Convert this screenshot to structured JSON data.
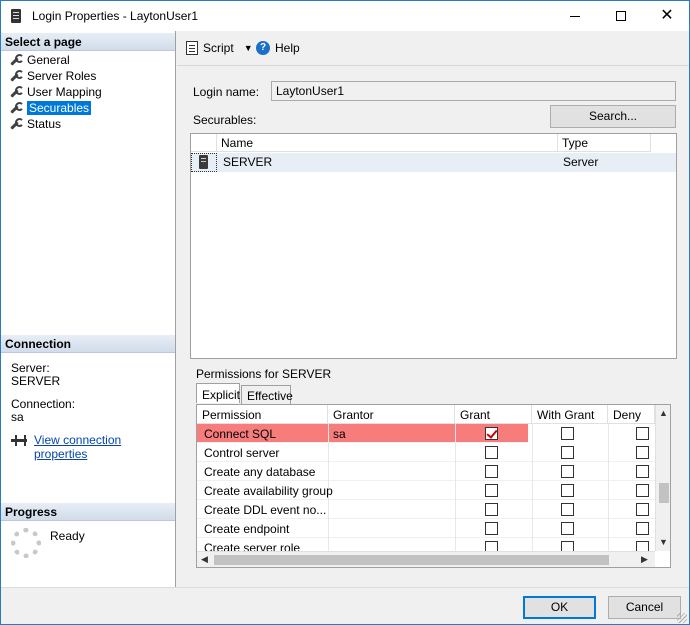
{
  "window": {
    "title": "Login Properties - LaytonUser1",
    "minimize": "—",
    "maximize": "□",
    "close": "✕"
  },
  "left": {
    "select_page_heading": "Select a page",
    "nav_items": [
      {
        "label": "General"
      },
      {
        "label": "Server Roles"
      },
      {
        "label": "User Mapping"
      },
      {
        "label": "Securables",
        "selected": true
      },
      {
        "label": "Status"
      }
    ],
    "connection_heading": "Connection",
    "server_label": "Server:",
    "server_value": "SERVER",
    "connection_label": "Connection:",
    "connection_value": "sa",
    "view_connection_link": "View connection properties",
    "progress_heading": "Progress",
    "progress_status": "Ready"
  },
  "toolbar": {
    "script_label": "Script",
    "script_dropdown": "▼",
    "help_label": "Help",
    "help_glyph": "?"
  },
  "login": {
    "label": "Login name:",
    "value": "LaytonUser1"
  },
  "securables": {
    "label": "Securables:",
    "search_button": "Search...",
    "columns": [
      "Name",
      "Type"
    ],
    "rows": [
      {
        "name": "SERVER",
        "type": "Server"
      }
    ]
  },
  "permissions": {
    "label": "Permissions for SERVER",
    "tabs": [
      {
        "label": "Explicit",
        "active": true
      },
      {
        "label": "Effective",
        "active": false
      }
    ],
    "columns": [
      "Permission",
      "Grantor",
      "Grant",
      "With Grant",
      "Deny"
    ],
    "rows": [
      {
        "permission": "Connect SQL",
        "grantor": "sa",
        "grant": true,
        "with_grant": false,
        "deny": false,
        "highlight": true
      },
      {
        "permission": "Control server",
        "grantor": "",
        "grant": false,
        "with_grant": false,
        "deny": false
      },
      {
        "permission": "Create any database",
        "grantor": "",
        "grant": false,
        "with_grant": false,
        "deny": false
      },
      {
        "permission": "Create availability group",
        "grantor": "",
        "grant": false,
        "with_grant": false,
        "deny": false
      },
      {
        "permission": "Create DDL event no...",
        "grantor": "",
        "grant": false,
        "with_grant": false,
        "deny": false
      },
      {
        "permission": "Create endpoint",
        "grantor": "",
        "grant": false,
        "with_grant": false,
        "deny": false
      },
      {
        "permission": "Create server role",
        "grantor": "",
        "grant": false,
        "with_grant": false,
        "deny": false
      }
    ],
    "highlight_color": "#f77d7d",
    "scroll_up": "▲",
    "scroll_down": "▼",
    "scroll_left": "◀",
    "scroll_right": "▶"
  },
  "footer": {
    "ok_button": "OK",
    "cancel_button": "Cancel"
  }
}
